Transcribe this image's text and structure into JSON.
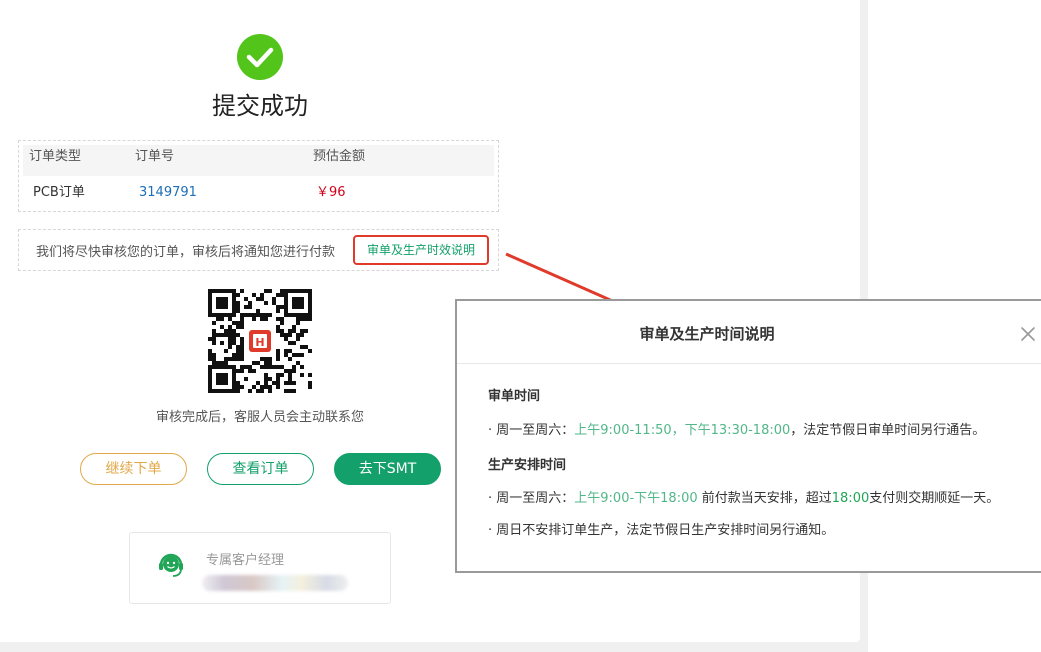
{
  "result": {
    "title": "提交成功"
  },
  "order": {
    "headers": [
      "订单类型",
      "订单号",
      "预估金额"
    ],
    "type": "PCB订单",
    "number": "3149791",
    "amount": "￥96"
  },
  "notice": {
    "text": "我们将尽快审核您的订单，审核后将通知您进行付款",
    "link": "审单及生产时效说明"
  },
  "qr": {
    "caption": "审核完成后，客服人员会主动联系您"
  },
  "actions": {
    "continue": "继续下单",
    "view": "查看订单",
    "smt": "去下SMT"
  },
  "manager": {
    "label": "专属客户经理"
  },
  "modal": {
    "title": "审单及生产时间说明",
    "audit_title": "审单时间",
    "audit_prefix": "· 周一至周六：",
    "audit_morning": "上午9:00-11:50",
    "audit_comma": "，",
    "audit_afternoon": "下午13:30-18:00",
    "audit_suffix": "，法定节假日审单时间另行通告。",
    "prod_title": "生产安排时间",
    "prod_prefix": "· 周一至周六：",
    "prod_range": "上午9:00-下午18:00",
    "prod_mid": " 前付款当天安排，超过",
    "prod_time": "18:00",
    "prod_suffix": "支付则交期顺延一天。",
    "sunday_note": "· 周日不安排订单生产，法定节假日生产安排时间另行通知。"
  },
  "colors": {
    "brand_green": "#13a06a",
    "success_green": "#52c41a",
    "accent_red": "#e03a2a",
    "price_red": "#d0021b",
    "continue_orange": "#e2a84a"
  }
}
